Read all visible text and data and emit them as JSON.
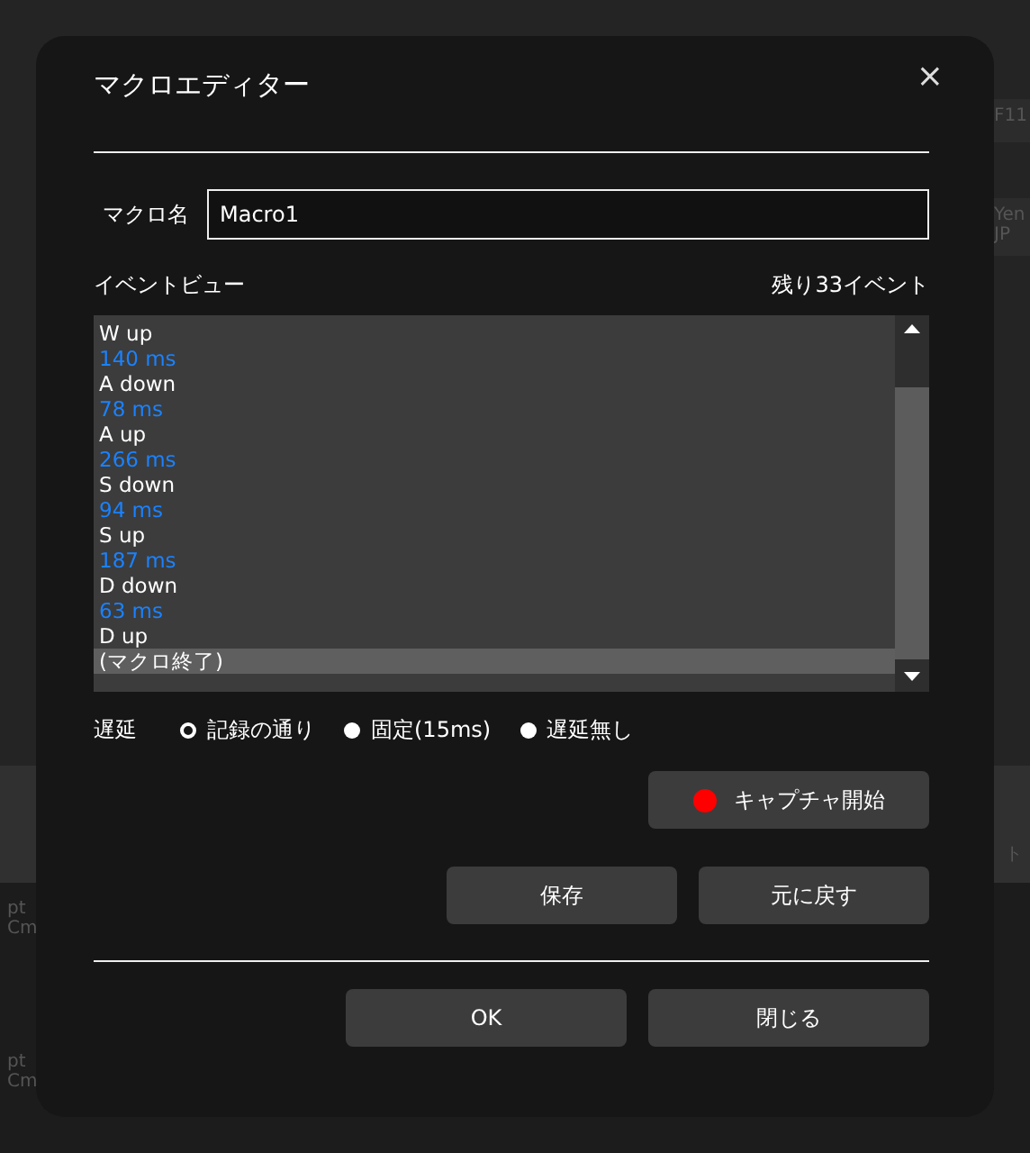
{
  "background": {
    "labels": [
      {
        "text": "F11",
        "kind": "key"
      },
      {
        "text": "Yen\nJP",
        "kind": "key"
      },
      {
        "text": "ト",
        "kind": "tab"
      },
      {
        "text": "pt\nCm",
        "kind": "side"
      },
      {
        "text": "pt\nCm",
        "kind": "side"
      }
    ]
  },
  "dialog": {
    "title": "マクロエディター",
    "close": "×",
    "name_field": {
      "label": "マクロ名",
      "value": "Macro1"
    },
    "event_view": {
      "label": "イベントビュー",
      "remaining": "残り33イベント",
      "items": [
        {
          "text": "W up",
          "kind": "event",
          "selected": false
        },
        {
          "text": "140 ms",
          "kind": "delay",
          "selected": false
        },
        {
          "text": "A down",
          "kind": "event",
          "selected": false
        },
        {
          "text": "78 ms",
          "kind": "delay",
          "selected": false
        },
        {
          "text": "A up",
          "kind": "event",
          "selected": false
        },
        {
          "text": "266 ms",
          "kind": "delay",
          "selected": false
        },
        {
          "text": "S down",
          "kind": "event",
          "selected": false
        },
        {
          "text": "94 ms",
          "kind": "delay",
          "selected": false
        },
        {
          "text": "S up",
          "kind": "event",
          "selected": false
        },
        {
          "text": "187 ms",
          "kind": "delay",
          "selected": false
        },
        {
          "text": "D down",
          "kind": "event",
          "selected": false
        },
        {
          "text": "63 ms",
          "kind": "delay",
          "selected": false
        },
        {
          "text": "D up",
          "kind": "event",
          "selected": false
        },
        {
          "text": "(マクロ終了)",
          "kind": "event",
          "selected": true
        }
      ]
    },
    "delay": {
      "label": "遅延",
      "options": [
        {
          "label": "記録の通り",
          "selected": true
        },
        {
          "label": "固定(15ms)",
          "selected": false
        },
        {
          "label": "遅延無し",
          "selected": false
        }
      ]
    },
    "capture_button": "キャプチャ開始",
    "edit_buttons": [
      "保存",
      "元に戻す"
    ],
    "footer_buttons": [
      "OK",
      "閉じる"
    ]
  }
}
